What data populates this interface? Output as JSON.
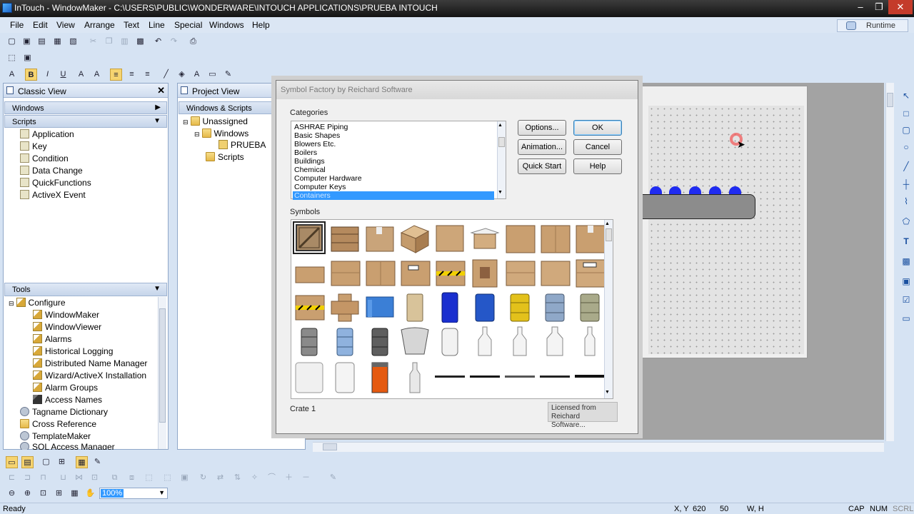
{
  "window": {
    "title": "InTouch - WindowMaker - C:\\USERS\\PUBLIC\\WONDERWARE\\INTOUCH APPLICATIONS\\PRUEBA INTOUCH",
    "minimize": "–",
    "restore": "❐",
    "close": "✕"
  },
  "menu": [
    "File",
    "Edit",
    "View",
    "Arrange",
    "Text",
    "Line",
    "Special",
    "Windows",
    "Help"
  ],
  "runtime_label": "Runtime",
  "classic_view": {
    "title": "Classic View",
    "windows_header": "Windows",
    "scripts_header": "Scripts",
    "scripts": [
      "Application",
      "Key",
      "Condition",
      "Data Change",
      "QuickFunctions",
      "ActiveX Event"
    ],
    "tools_header": "Tools",
    "configure_label": "Configure",
    "configure_items": [
      "WindowMaker",
      "WindowViewer",
      "Alarms",
      "Historical Logging",
      "Distributed Name Manager",
      "Wizard/ActiveX Installation",
      "Alarm Groups",
      "Access Names"
    ],
    "other_tools": [
      "Tagname Dictionary",
      "Cross Reference",
      "TemplateMaker",
      "SQL Access Manager"
    ]
  },
  "project_view": {
    "title": "Project View",
    "header": "Windows & Scripts",
    "unassigned": "Unassigned",
    "windows": "Windows",
    "prueba": "PRUEBA",
    "scripts": "Scripts"
  },
  "dialog": {
    "title": "Symbol Factory by Reichard Software",
    "categories_label": "Categories",
    "categories": [
      "ASHRAE Piping",
      "Basic Shapes",
      "Blowers Etc.",
      "Boilers",
      "Buildings",
      "Chemical",
      "Computer Hardware",
      "Computer Keys",
      "Containers"
    ],
    "selected_category": "Containers",
    "buttons": {
      "options": "Options...",
      "animation": "Animation...",
      "quick_start": "Quick Start",
      "ok": "OK",
      "cancel": "Cancel",
      "help": "Help"
    },
    "symbols_label": "Symbols",
    "selected_symbol": "Crate 1",
    "licensed_line1": "Licensed from",
    "licensed_line2": "Reichard Software..."
  },
  "zoom": "100%",
  "status": {
    "ready": "Ready",
    "xy_label": "X, Y",
    "x": "620",
    "y": "50",
    "wh_label": "W, H",
    "cap": "CAP",
    "num": "NUM",
    "scrl": "SCRL"
  }
}
